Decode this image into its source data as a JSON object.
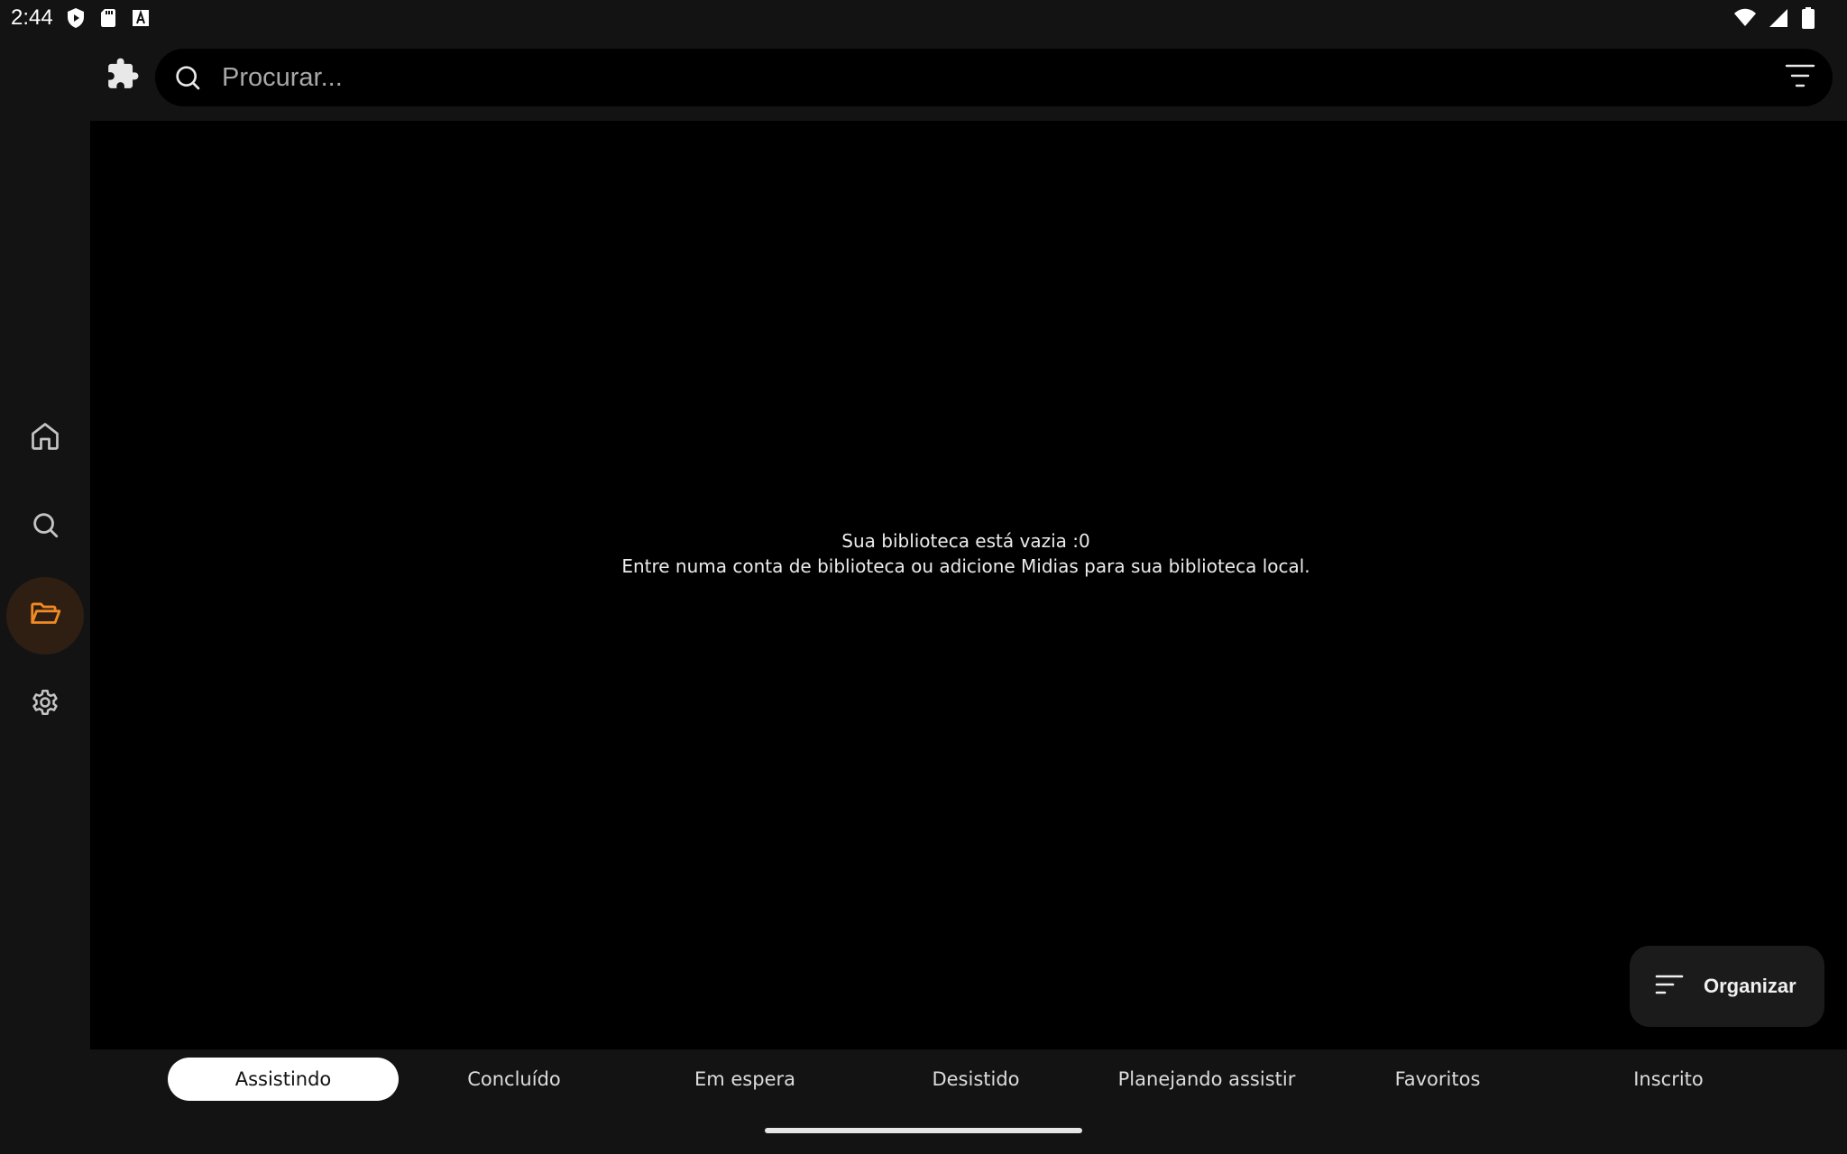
{
  "status_bar": {
    "time": "2:44",
    "left_icons": [
      "play-shield-icon",
      "sd-card-icon",
      "a-square-icon"
    ],
    "right_icons": [
      "wifi-icon",
      "signal-icon",
      "battery-icon"
    ]
  },
  "nav_rail": {
    "items": [
      {
        "id": "home",
        "icon": "home-icon",
        "active": false
      },
      {
        "id": "search",
        "icon": "search-icon",
        "active": false
      },
      {
        "id": "library",
        "icon": "folder-open-icon",
        "active": true
      },
      {
        "id": "settings",
        "icon": "gear-icon",
        "active": false
      }
    ]
  },
  "search": {
    "placeholder": "Procurar...",
    "value": ""
  },
  "library": {
    "empty_title": "Sua biblioteca está vazia :0",
    "empty_subtitle": "Entre numa conta de biblioteca ou adicione Midias para sua biblioteca local."
  },
  "fab": {
    "label": "Organizar"
  },
  "tabs": [
    {
      "label": "Assistindo",
      "active": true
    },
    {
      "label": "Concluído",
      "active": false
    },
    {
      "label": "Em espera",
      "active": false
    },
    {
      "label": "Desistido",
      "active": false
    },
    {
      "label": "Planejando assistir",
      "active": false
    },
    {
      "label": "Favoritos",
      "active": false
    },
    {
      "label": "Inscrito",
      "active": false
    }
  ],
  "colors": {
    "background": "#131313",
    "content": "#000000",
    "accent": "#f08a24",
    "active_indicator": "#2f1e12"
  }
}
